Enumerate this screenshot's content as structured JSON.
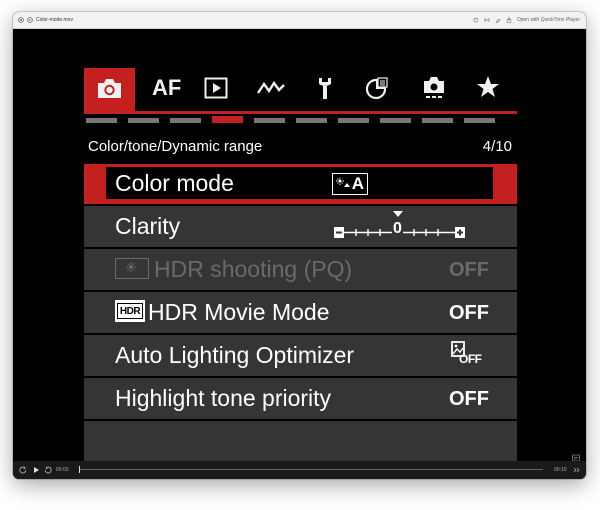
{
  "window": {
    "title": "Color-mode.mov",
    "open_with": "Open with QuickTime Player"
  },
  "camera_menu": {
    "tabs": [
      {
        "name": "shooting",
        "label": ""
      },
      {
        "name": "af",
        "label": "AF"
      },
      {
        "name": "playback",
        "label": ""
      },
      {
        "name": "network",
        "label": ""
      },
      {
        "name": "setup",
        "label": ""
      },
      {
        "name": "custom-functions",
        "label": ""
      },
      {
        "name": "custom-shooting",
        "label": ""
      },
      {
        "name": "my-menu",
        "label": ""
      }
    ],
    "active_tab": 0,
    "page_count": 10,
    "active_page": 4,
    "header": {
      "title": "Color/tone/Dynamic range",
      "page": "4/10"
    },
    "items": [
      {
        "label": "Color mode",
        "value": "A",
        "selected": true,
        "enabled": true
      },
      {
        "label": "Clarity",
        "value": "0",
        "selected": false,
        "enabled": true
      },
      {
        "label": "HDR shooting (PQ)",
        "value": "OFF",
        "selected": false,
        "enabled": false
      },
      {
        "label": "HDR Movie Mode",
        "value": "OFF",
        "icon_text": "HDR",
        "selected": false,
        "enabled": true
      },
      {
        "label": "Auto Lighting Optimizer",
        "value": "OFF",
        "selected": false,
        "enabled": true
      },
      {
        "label": "Highlight tone priority",
        "value": "OFF",
        "selected": false,
        "enabled": true
      }
    ]
  },
  "player": {
    "current_time": "00:00",
    "total_time": "00:10",
    "progress": 0.0
  },
  "colors": {
    "accent_red": "#c42020",
    "row_bg": "#353535",
    "dim_text": "#6a6a6a"
  }
}
